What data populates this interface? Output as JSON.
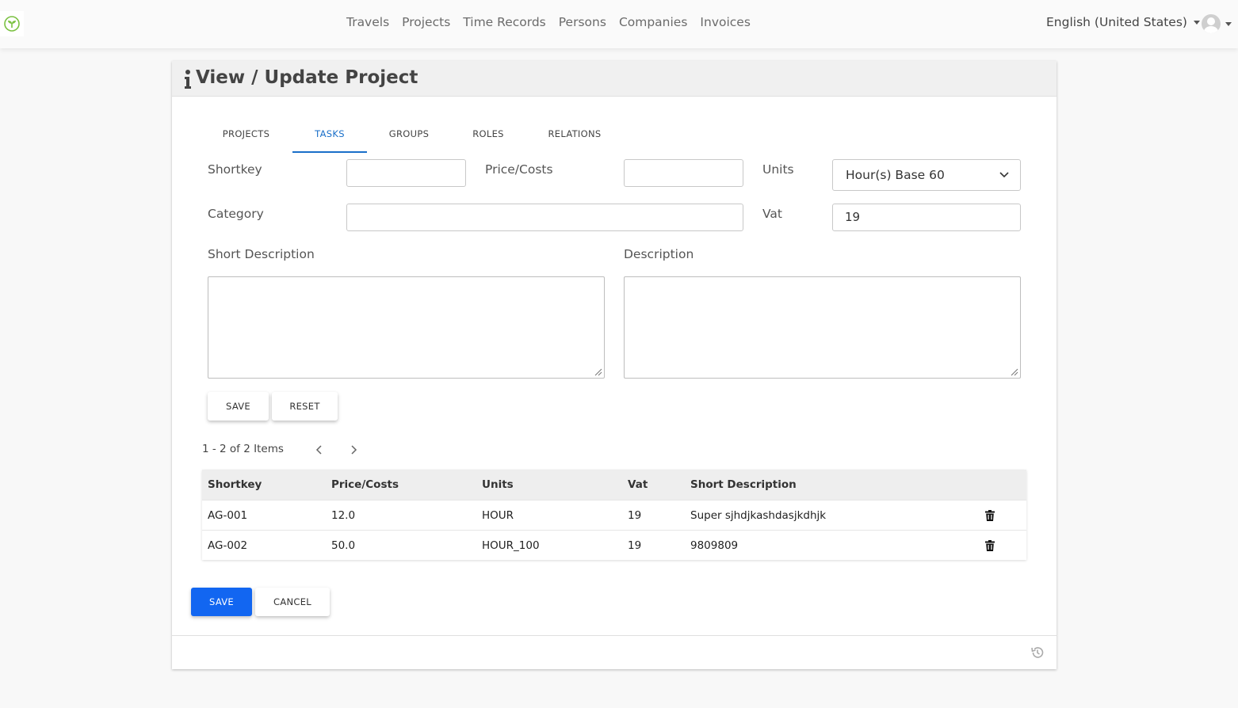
{
  "nav": {
    "links": [
      "Travels",
      "Projects",
      "Time Records",
      "Persons",
      "Companies",
      "Invoices"
    ],
    "language": "English (United States)",
    "logo_icon": "sprout-logo-icon",
    "avatar_icon": "user-avatar-icon"
  },
  "page": {
    "title": "View / Update Project",
    "title_icon": "info-icon"
  },
  "tabs": [
    {
      "label": "PROJECTS",
      "active": false
    },
    {
      "label": "TASKS",
      "active": true
    },
    {
      "label": "GROUPS",
      "active": false
    },
    {
      "label": "ROLES",
      "active": false
    },
    {
      "label": "RELATIONS",
      "active": false
    }
  ],
  "form": {
    "shortkey_label": "Shortkey",
    "shortkey_value": "",
    "price_label": "Price/Costs",
    "price_value": "",
    "units_label": "Units",
    "units_value": "Hour(s) Base 60",
    "category_label": "Category",
    "category_value": "",
    "vat_label": "Vat",
    "vat_value": "19",
    "short_description_label": "Short Description",
    "description_label": "Description",
    "save_label": "SAVE",
    "reset_label": "RESET"
  },
  "pager": {
    "text": "1 - 2 of 2 Items"
  },
  "table": {
    "headers": [
      "Shortkey",
      "Price/Costs",
      "Units",
      "Vat",
      "Short Description"
    ],
    "rows": [
      [
        "AG-001",
        "12.0",
        "HOUR",
        "19",
        "Super sjhdjkashdasjkdhjk"
      ],
      [
        "AG-002",
        "50.0",
        "HOUR_100",
        "19",
        "9809809"
      ]
    ],
    "row_action_icon": "trash-icon"
  },
  "footer_buttons": {
    "save_label": "SAVE",
    "cancel_label": "CANCEL"
  },
  "colors": {
    "primary": "#1266f1",
    "active_tab": "#1a6fc9",
    "logo_green": "#7bc142"
  }
}
